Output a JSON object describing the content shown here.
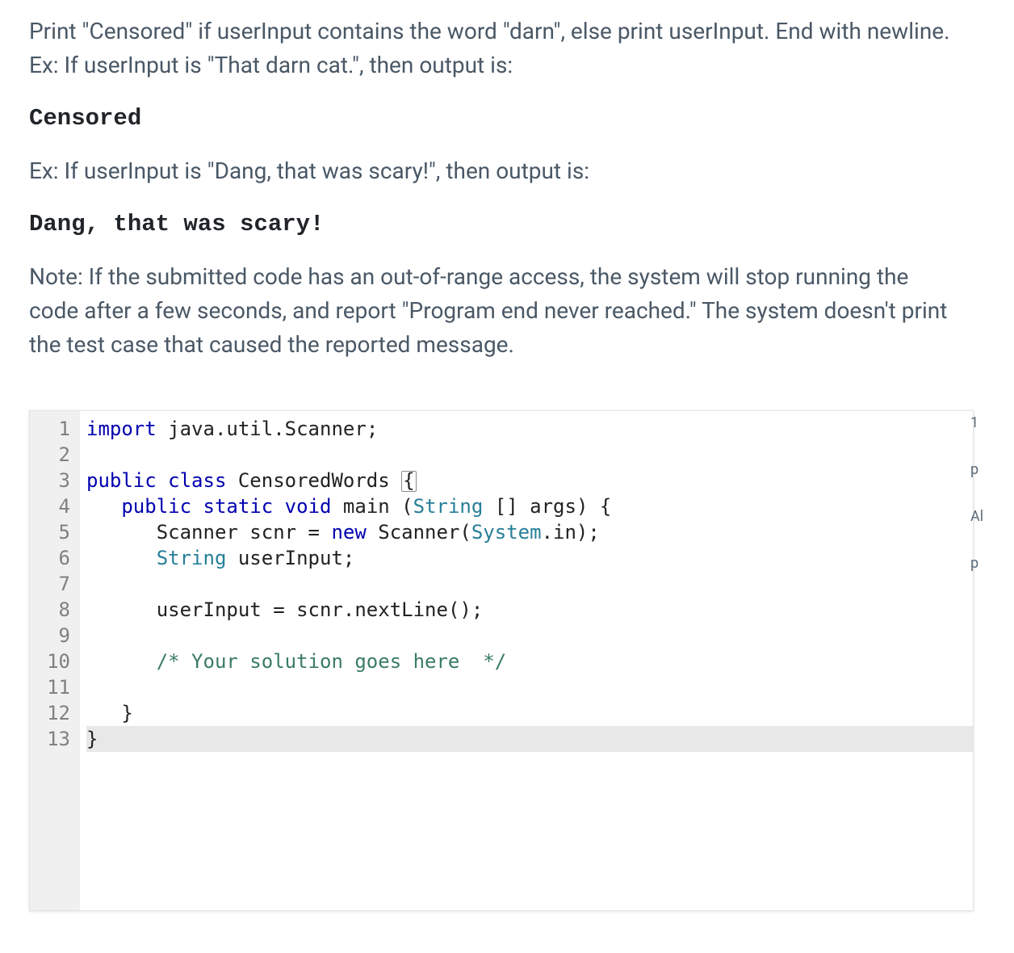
{
  "problem": {
    "intro": "Print \"Censored\" if userInput contains the word \"darn\", else print userInput. End with newline. Ex: If userInput is \"That darn cat.\", then output is:",
    "ex1_output": "Censored",
    "ex2_prompt": "Ex: If userInput is \"Dang, that was scary!\", then output is:",
    "ex2_output": "Dang, that was scary!",
    "note": "Note: If the submitted code has an out-of-range access, the system will stop running the code after a few seconds, and report \"Program end never reached.\" The system doesn't print the test case that caused the reported message."
  },
  "editor": {
    "lines": [
      {
        "n": "1",
        "tokens": [
          [
            "kw",
            "import"
          ],
          [
            "",
            " java"
          ],
          [
            "punct",
            "."
          ],
          [
            "",
            "util"
          ],
          [
            "punct",
            "."
          ],
          [
            "",
            "Scanner"
          ],
          [
            "punct",
            ";"
          ]
        ]
      },
      {
        "n": "2",
        "tokens": []
      },
      {
        "n": "3",
        "tokens": [
          [
            "kw",
            "public"
          ],
          [
            "",
            " "
          ],
          [
            "kw",
            "class"
          ],
          [
            "",
            " CensoredWords "
          ],
          [
            "bracket",
            "{"
          ]
        ]
      },
      {
        "n": "4",
        "indent": 1,
        "tokens": [
          [
            "kw",
            "public"
          ],
          [
            "",
            " "
          ],
          [
            "kw",
            "static"
          ],
          [
            "",
            " "
          ],
          [
            "kw",
            "void"
          ],
          [
            "",
            " main "
          ],
          [
            "punct",
            "("
          ],
          [
            "type",
            "String"
          ],
          [
            "",
            " "
          ],
          [
            "punct",
            "[]"
          ],
          [
            "",
            " args"
          ],
          [
            "punct",
            ") {"
          ]
        ]
      },
      {
        "n": "5",
        "indent": 2,
        "tokens": [
          [
            "",
            "Scanner scnr "
          ],
          [
            "punct",
            "="
          ],
          [
            "",
            " "
          ],
          [
            "kw",
            "new"
          ],
          [
            "",
            " Scanner"
          ],
          [
            "punct",
            "("
          ],
          [
            "type",
            "System"
          ],
          [
            "punct",
            "."
          ],
          [
            "",
            "in"
          ],
          [
            "punct",
            ");"
          ]
        ]
      },
      {
        "n": "6",
        "indent": 2,
        "tokens": [
          [
            "type",
            "String"
          ],
          [
            "",
            " userInput"
          ],
          [
            "punct",
            ";"
          ]
        ]
      },
      {
        "n": "7",
        "indent": 0,
        "tokens": []
      },
      {
        "n": "8",
        "indent": 2,
        "tokens": [
          [
            "",
            "userInput "
          ],
          [
            "punct",
            "="
          ],
          [
            "",
            " scnr"
          ],
          [
            "punct",
            "."
          ],
          [
            "",
            "nextLine"
          ],
          [
            "punct",
            "();"
          ]
        ]
      },
      {
        "n": "9",
        "indent": 0,
        "tokens": []
      },
      {
        "n": "10",
        "indent": 2,
        "tokens": [
          [
            "cmt",
            "/* Your solution goes here  */"
          ]
        ]
      },
      {
        "n": "11",
        "indent": 0,
        "tokens": []
      },
      {
        "n": "12",
        "indent": 1,
        "tokens": [
          [
            "punct",
            "}"
          ]
        ]
      },
      {
        "n": "13",
        "cursor": true,
        "tokens": [
          [
            "punct",
            "}"
          ]
        ]
      }
    ]
  },
  "sidecut": [
    "1",
    "p",
    "Al",
    "p"
  ]
}
